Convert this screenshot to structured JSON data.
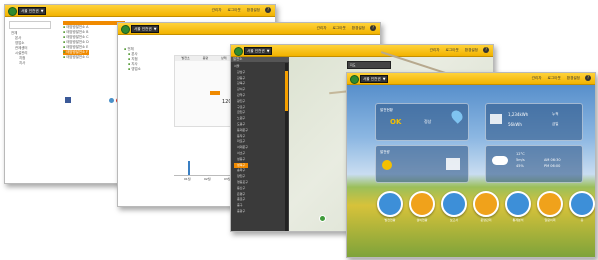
{
  "brand_color": "#f5c000",
  "selected_color": "#f08a00",
  "win1": {
    "title_select": "서울 인천권",
    "bar_items": [
      "관리자",
      "로그아웃",
      "환경설정"
    ],
    "tree_left": [
      "전체",
      "본사",
      "영업소",
      "관제센터",
      "시설관리",
      "지점",
      "지사"
    ],
    "list_right": [
      "태양광발전소 A",
      "태양광발전소 B",
      "태양광발전소 C",
      "태양광발전소 D",
      "태양광발전소 E",
      "태양광발전소 F",
      "태양광발전소 G"
    ],
    "search_label": "검색"
  },
  "win2": {
    "title_select": "서울 인천권",
    "bar_items": [
      "관리자",
      "로그아웃",
      "환경설정"
    ],
    "tree": [
      "전체",
      "본사",
      "지점",
      "지사",
      "영업소"
    ],
    "table_header": [
      "발전소",
      "용량",
      "상태"
    ],
    "total_value": "1201",
    "axis_labels": [
      "01월",
      "02월",
      "03월"
    ]
  },
  "win3": {
    "title_select": "서울 인천권",
    "bar_items": [
      "관리자",
      "로그아웃",
      "환경설정"
    ],
    "tree_header": "발전소",
    "tree": [
      "서울",
      "강남구",
      "강동구",
      "강북구",
      "강서구",
      "관악구",
      "광진구",
      "구로구",
      "금천구",
      "노원구",
      "도봉구",
      "동대문구",
      "동작구",
      "마포구",
      "서대문구",
      "서초구",
      "성동구",
      "성북구",
      "송파구",
      "양천구",
      "영등포구",
      "용산구",
      "은평구",
      "종로구",
      "중구",
      "중랑구"
    ],
    "map_select": "지도"
  },
  "win4": {
    "title_select": "서울 인천권",
    "bar_items": [
      "관리자",
      "로그아웃",
      "환경설정"
    ],
    "tile1": {
      "title": "발전현황",
      "value": "OK",
      "label": "정상"
    },
    "tile2": {
      "line1": "1,234kWh",
      "line2": "56kWh",
      "unit1": "누적",
      "unit2": "금일"
    },
    "tile3": {
      "label": "발전량"
    },
    "tile4": {
      "temp": "12°C",
      "wind": "5m/s",
      "humidity": "45%",
      "time1": "AM 06:30",
      "time2": "PM 06:00"
    },
    "buttons": [
      "발전현황",
      "설비현황",
      "보고서",
      "운영관리",
      "통계분석",
      "알람이력",
      "홈"
    ]
  }
}
